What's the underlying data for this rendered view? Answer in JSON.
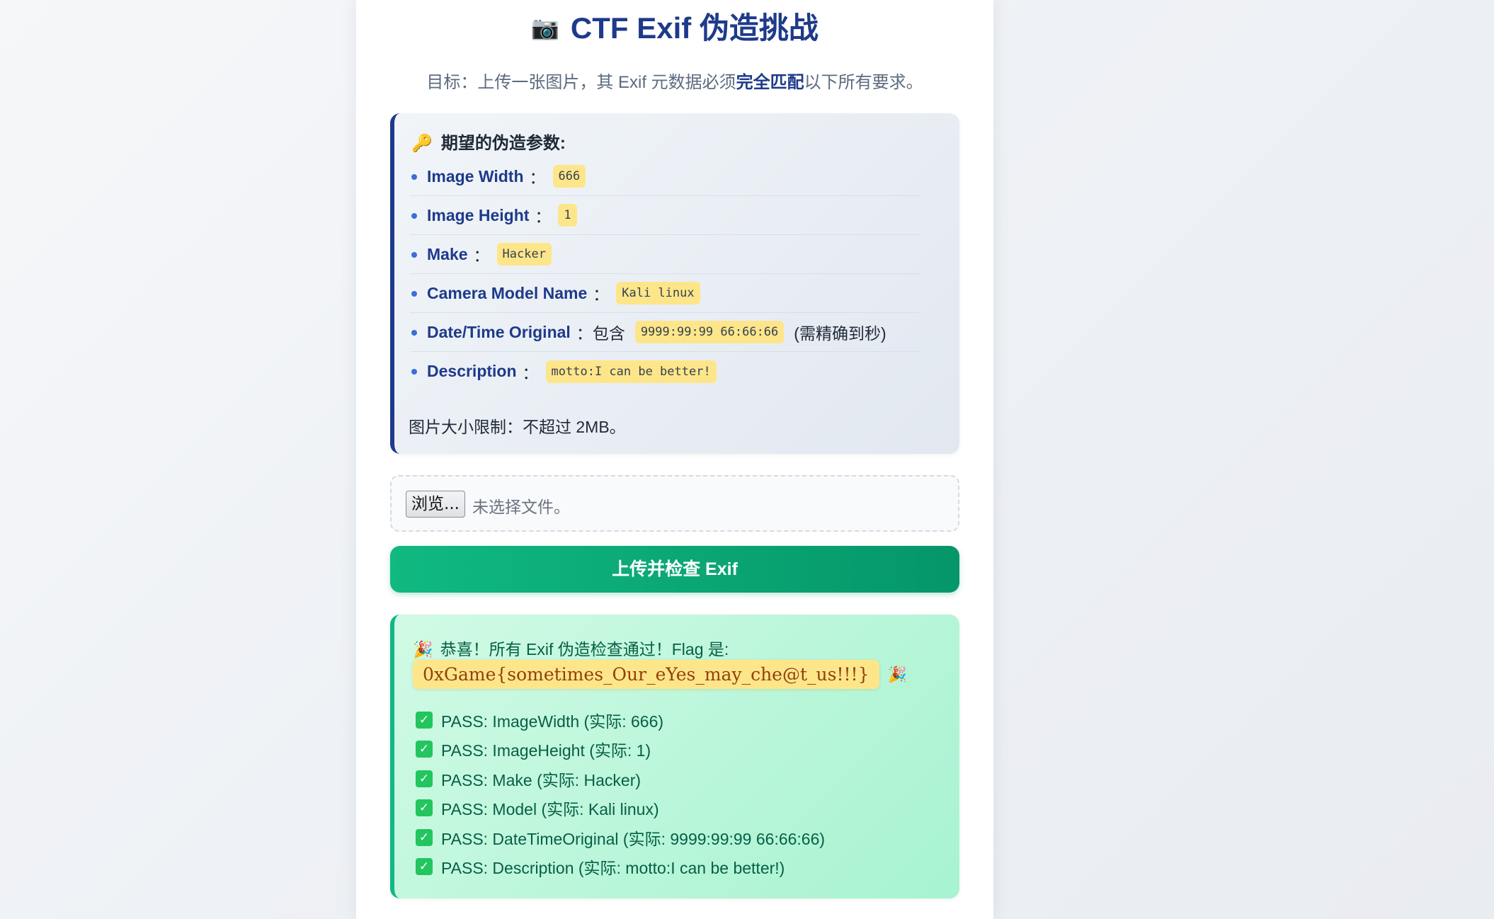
{
  "page": {
    "title_icon": "camera-emoji",
    "title": "CTF Exif 伪造挑战",
    "subtitle_prefix": "目标：上传一张图片，其 Exif 元数据必须",
    "subtitle_bold": "完全匹配",
    "subtitle_suffix": "以下所有要求。"
  },
  "requirements": {
    "heading": "期望的伪造参数:",
    "heading_icon": "key-emoji",
    "items": [
      {
        "label": "Image Width",
        "sep": "：",
        "value": "666",
        "before": "",
        "after": ""
      },
      {
        "label": "Image Height",
        "sep": "：",
        "value": "1",
        "before": "",
        "after": ""
      },
      {
        "label": "Make",
        "sep": "：",
        "value": "Hacker",
        "before": "",
        "after": ""
      },
      {
        "label": "Camera Model Name",
        "sep": "：",
        "value": "Kali linux",
        "before": "",
        "after": ""
      },
      {
        "label": "Date/Time Original",
        "sep": "：",
        "value": "9999:99:99 66:66:66",
        "before": "包含",
        "after": "(需精确到秒)"
      },
      {
        "label": "Description",
        "sep": "：",
        "value": "motto:I can be better!",
        "before": "",
        "after": ""
      }
    ],
    "size_note": "图片大小限制：不超过 2MB。"
  },
  "upload": {
    "browse_label": "浏览...",
    "file_status": "未选择文件。",
    "submit_label": "上传并检查 Exif"
  },
  "result": {
    "icon": "party-popper-emoji",
    "congrats": "恭喜！所有 Exif 伪造检查通过！Flag 是:",
    "flag": "0xGame{sometimes_Our_eYes_may_che@t_us!!!}",
    "checks": [
      "PASS: ImageWidth (实际: 666)",
      "PASS: ImageHeight (实际: 1)",
      "PASS: Make (实际: Hacker)",
      "PASS: Model (实际: Kali linux)",
      "PASS: DateTimeOriginal (实际: 9999:99:99 66:66:66)",
      "PASS: Description (实际: motto:I can be better!)"
    ]
  },
  "colors": {
    "brand": "#1e3a8a",
    "success": "#10b981",
    "highlight": "#fde68a"
  }
}
